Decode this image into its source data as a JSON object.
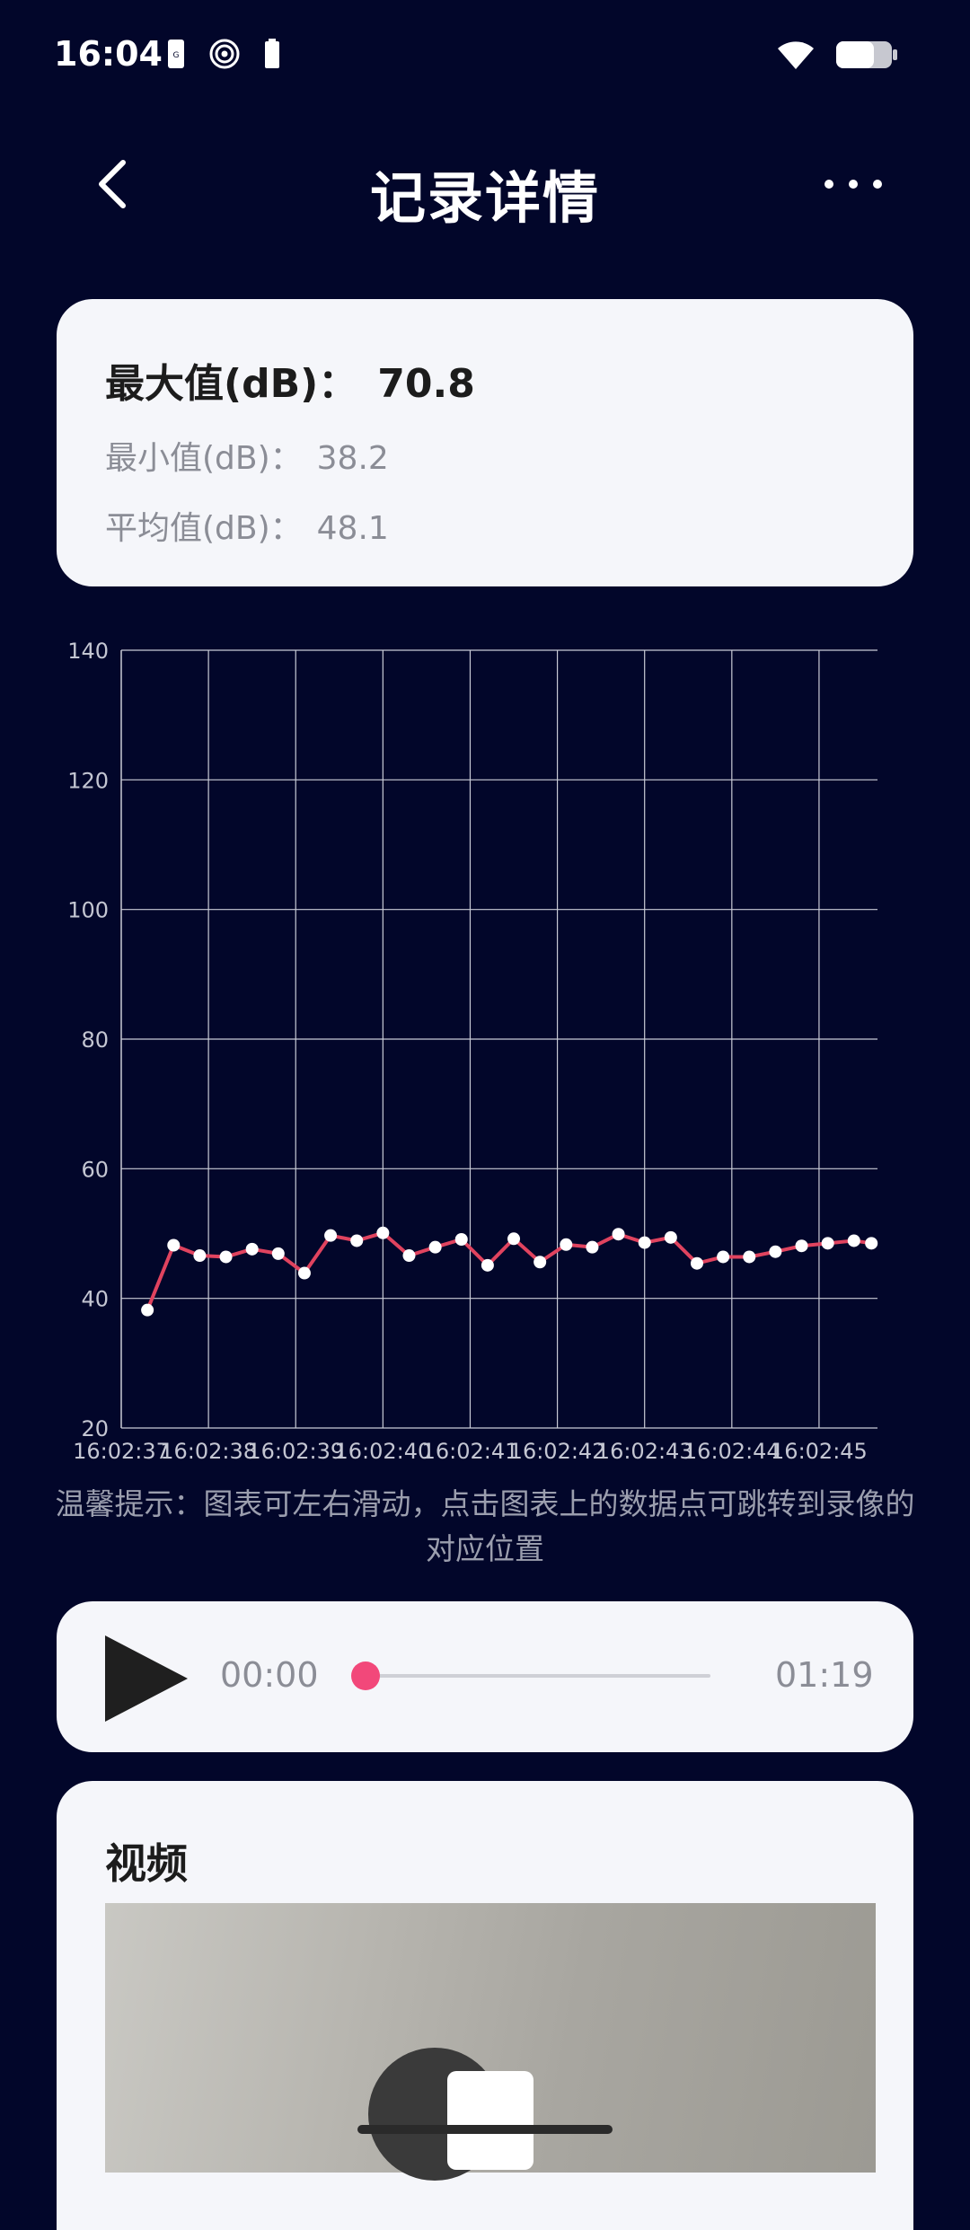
{
  "status_bar": {
    "time": "16:04",
    "left_icons": [
      "sim-card-icon",
      "hotspot-icon",
      "battery-saver-icon"
    ],
    "right_icons": [
      "wifi-icon",
      "battery-icon"
    ]
  },
  "header": {
    "title": "记录详情",
    "back_icon": "chevron-left-icon",
    "more_icon": "more-horizontal-icon"
  },
  "stats": {
    "max_label": "最大值(dB)：",
    "max_value": "70.8",
    "min_label": "最小值(dB)：",
    "min_value": "38.2",
    "avg_label": "平均值(dB)：",
    "avg_value": "48.1"
  },
  "chart_data": {
    "type": "line",
    "ylim": [
      20,
      140
    ],
    "y_ticks": [
      "20",
      "40",
      "60",
      "80",
      "100",
      "120",
      "140"
    ],
    "x_ticks": [
      "16:02:37",
      "16:02:38",
      "16:02:39",
      "16:02:40",
      "16:02:41",
      "16:02:42",
      "16:02:43",
      "16:02:44",
      "16:02:45"
    ],
    "grid": true,
    "colors": {
      "line": "#e0435f",
      "point": "#ffffff",
      "grid": "#c9cbd6",
      "axis_text": "#c4c6d2"
    },
    "series": [
      {
        "x": [
          37.3,
          37.6,
          37.9,
          38.2,
          38.5,
          38.8,
          39.1,
          39.4,
          39.7,
          40.0,
          40.3,
          40.6,
          40.9,
          41.2,
          41.5,
          41.8,
          42.1,
          42.4,
          42.7,
          43.0,
          43.3,
          43.6,
          43.9,
          44.2,
          44.5,
          44.8,
          45.1,
          45.4,
          45.6
        ],
        "values": [
          38.2,
          48.2,
          46.6,
          46.4,
          47.6,
          46.9,
          43.9,
          49.7,
          48.9,
          50.1,
          46.6,
          47.9,
          49.1,
          45.1,
          49.2,
          45.6,
          48.3,
          47.9,
          49.9,
          48.6,
          49.4,
          45.4,
          46.4,
          46.4,
          47.2,
          48.1,
          48.5,
          48.9,
          48.5
        ]
      }
    ]
  },
  "tip": "温馨提示：图表可左右滑动，点击图表上的数据点可跳转到录像的对应位置",
  "player": {
    "play_icon": "play-icon",
    "current_time": "00:00",
    "total_time": "01:19",
    "progress": 0,
    "accent": "#f2487a"
  },
  "video": {
    "title": "视频"
  }
}
